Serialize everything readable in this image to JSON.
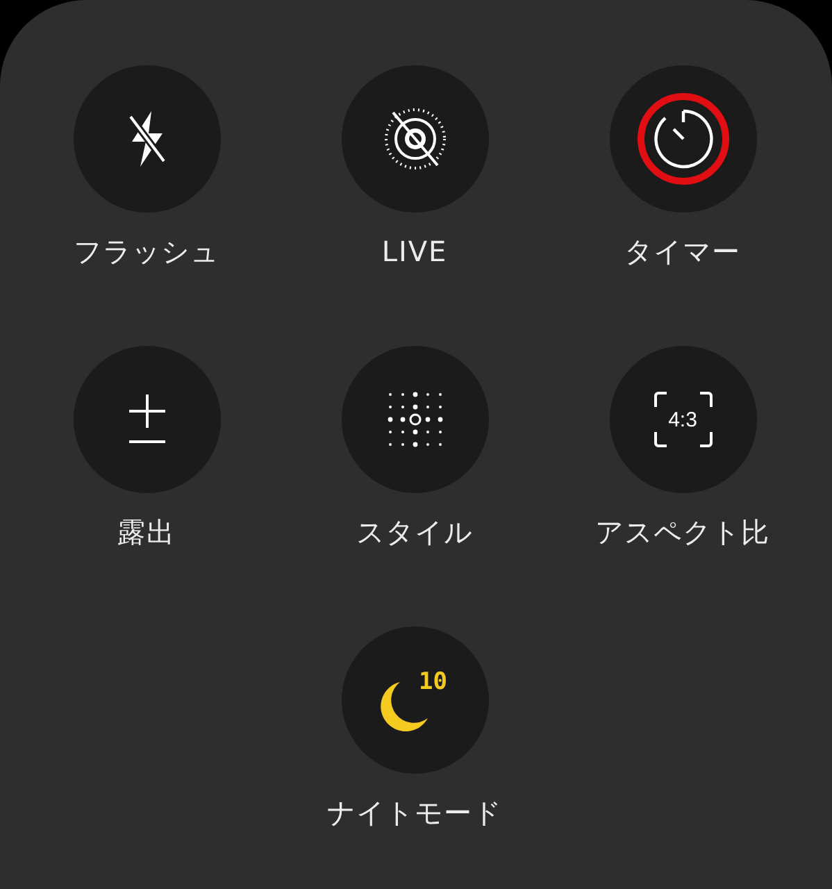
{
  "controls": [
    {
      "kind": "flash",
      "label": "フラッシュ",
      "active": false,
      "highlighted": false
    },
    {
      "kind": "live",
      "label": "LIVE",
      "active": false,
      "highlighted": false
    },
    {
      "kind": "timer",
      "label": "タイマー",
      "active": false,
      "highlighted": true
    },
    {
      "kind": "exposure",
      "label": "露出",
      "active": false,
      "highlighted": false
    },
    {
      "kind": "style",
      "label": "スタイル",
      "active": false,
      "highlighted": false
    },
    {
      "kind": "aspect",
      "label": "アスペクト比",
      "icon_text": "4:3",
      "active": false,
      "highlighted": false
    },
    {
      "kind": "night",
      "label": "ナイトモード",
      "icon_text": "10",
      "active": true,
      "highlighted": false
    }
  ]
}
